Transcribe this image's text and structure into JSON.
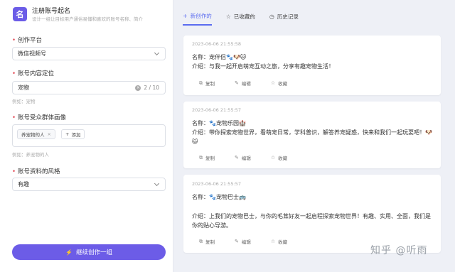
{
  "app": {
    "logo_char": "名",
    "title": "注册账号起名",
    "description": "设计一组让目标用户通俗易懂和喜欢的账号名称、简介"
  },
  "form": {
    "platform": {
      "label": "创作平台",
      "value": "微信视频号"
    },
    "positioning": {
      "label": "账号内容定位",
      "value": "宠物",
      "count": "2 / 10",
      "hint": "例如：宠物"
    },
    "audience": {
      "label": "账号受众群体画像",
      "tag": "养宠物的人",
      "add_label": "添加",
      "hint": "例如：养宠物的人"
    },
    "style": {
      "label": "账号资料的风格",
      "value": "有趣"
    },
    "submit_label": "继续创作一组"
  },
  "tabs": [
    {
      "label": "新创作的",
      "icon": "plus-icon",
      "active": true
    },
    {
      "label": "已收藏的",
      "icon": "star-icon",
      "active": false
    },
    {
      "label": "历史记录",
      "icon": "clock-icon",
      "active": false
    }
  ],
  "results": [
    {
      "time": "2023-06-06 21:55:58",
      "name_label": "名称：",
      "name": "宠伴侣",
      "name_emoji": "🐾🐶🐱",
      "intro_label": "介绍：",
      "intro": "与我一起开启萌宠互动之旅，分享有趣宠物生活！",
      "intro_emoji": ""
    },
    {
      "time": "2023-06-06 21:55:57",
      "name_label": "名称：",
      "name": "宠物乐园",
      "name_emoji": "🐾",
      "name_suffix_emoji": "🏰",
      "intro_label": "介绍：",
      "intro": "带你探索宠物世界，看萌宠日常，学科普识，解答养宠疑惑，快来和我们一起玩耍吧！",
      "intro_emoji": "🐶🐱"
    },
    {
      "time": "2023-06-06 21:55:57",
      "name_label": "名称：",
      "name": "宠物巴士",
      "name_emoji": "🐾",
      "name_suffix_emoji": "🚌",
      "intro_label": "介绍：",
      "intro": "上我们的宠物巴士，与你的毛茸好友一起启程探索宠物世界！有趣、实用、全面，我们是你的贴心导游。",
      "intro_emoji": ""
    }
  ],
  "actions": {
    "copy": "复制",
    "edit": "编辑",
    "favorite": "收藏"
  },
  "watermark": "知乎 @听雨"
}
